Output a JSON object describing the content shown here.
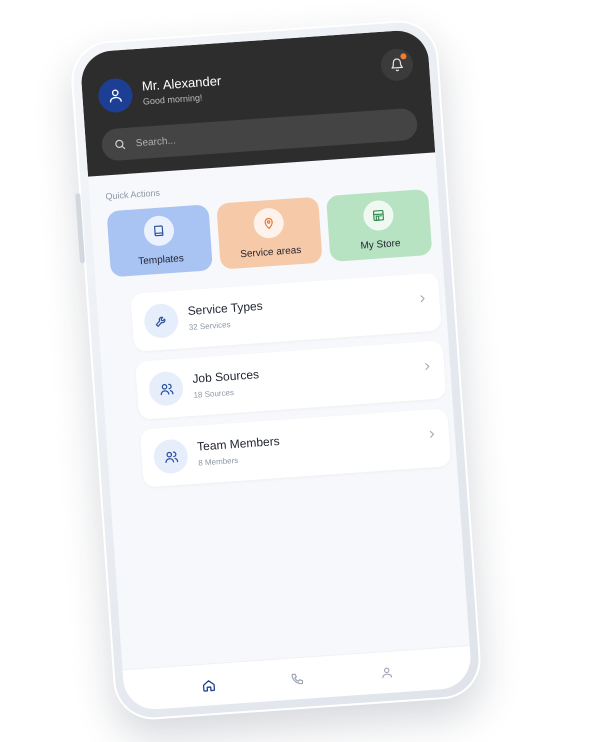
{
  "header": {
    "user_name": "Mr. Alexander",
    "greeting": "Good morning!",
    "notification_dot_color": "#f47a2c",
    "avatar_color": "#1c3f95"
  },
  "search": {
    "placeholder": "Search..."
  },
  "quick_actions": {
    "title": "Quick Actions",
    "items": [
      {
        "label": "Templates",
        "icon": "book-icon",
        "color": "#a9c3f3"
      },
      {
        "label": "Service areas",
        "icon": "map-pin-icon",
        "color": "#f6c9a8"
      },
      {
        "label": "My Store",
        "icon": "store-icon",
        "color": "#b7e3c2"
      }
    ]
  },
  "list": {
    "items": [
      {
        "title": "Service Types",
        "subtitle": "32 Services",
        "icon": "wrench-icon"
      },
      {
        "title": "Job Sources",
        "subtitle": "18 Sources",
        "icon": "users-icon"
      },
      {
        "title": "Team Members",
        "subtitle": "8 Members",
        "icon": "users-icon"
      }
    ]
  },
  "bottom_nav": {
    "items": [
      {
        "icon": "home-icon",
        "active": true
      },
      {
        "icon": "phone-icon",
        "active": false
      },
      {
        "icon": "profile-icon",
        "active": false
      }
    ],
    "active_color": "#1c3f95",
    "inactive_color": "#9aa3b0"
  }
}
